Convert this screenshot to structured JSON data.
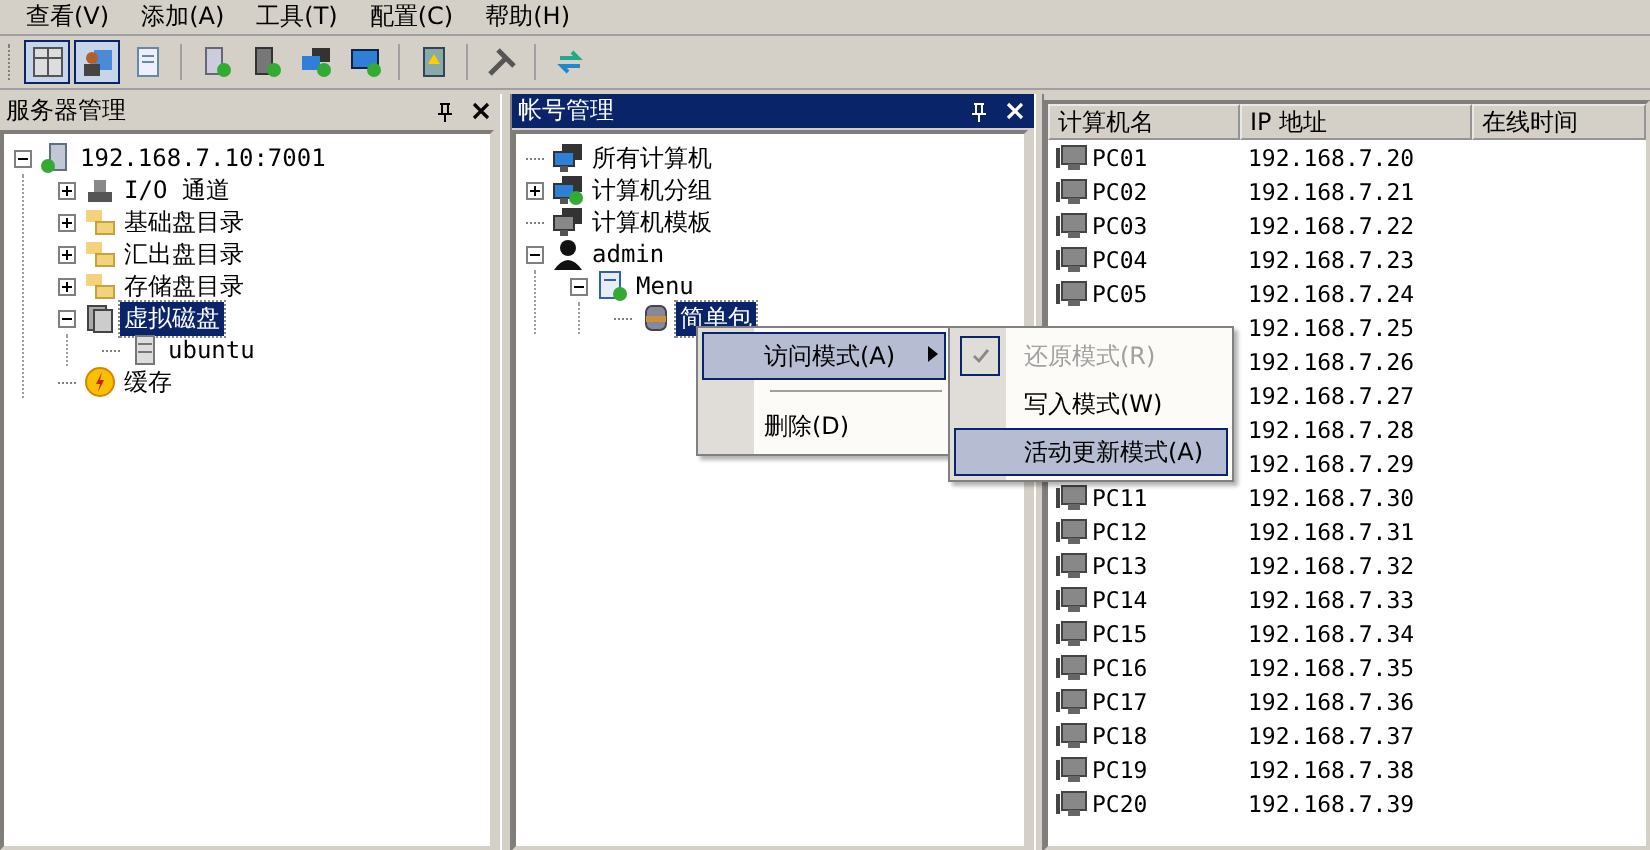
{
  "menu_bar": [
    {
      "label": "查看(V)"
    },
    {
      "label": "添加(A)"
    },
    {
      "label": "工具(T)"
    },
    {
      "label": "配置(C)"
    },
    {
      "label": "帮助(H)"
    }
  ],
  "toolbar": {
    "groups": [
      [
        {
          "kind": "grid",
          "pressed": true
        },
        {
          "kind": "person",
          "pressed": true
        },
        {
          "kind": "document",
          "pressed": false
        }
      ],
      [
        {
          "kind": "add-server",
          "pressed": false
        },
        {
          "kind": "add-tower",
          "pressed": false
        },
        {
          "kind": "add-network",
          "pressed": false
        },
        {
          "kind": "add-monitor",
          "pressed": false
        }
      ],
      [
        {
          "kind": "notebook",
          "pressed": false
        }
      ],
      [
        {
          "kind": "tools",
          "pressed": false
        }
      ],
      [
        {
          "kind": "refresh",
          "pressed": false
        }
      ]
    ]
  },
  "server_panel": {
    "title": "服务器管理",
    "tree": [
      {
        "label": "192.168.7.10:7001",
        "kind": "server",
        "expanded": true,
        "selected": false,
        "children": [
          {
            "label": "I/O 通道",
            "kind": "channel",
            "expanded": false,
            "selected": false
          },
          {
            "label": "基础盘目录",
            "kind": "folder",
            "expanded": false,
            "selected": false
          },
          {
            "label": "汇出盘目录",
            "kind": "folder",
            "expanded": false,
            "selected": false
          },
          {
            "label": "存储盘目录",
            "kind": "folder",
            "expanded": false,
            "selected": false
          },
          {
            "label": "虚拟磁盘",
            "kind": "disk",
            "expanded": true,
            "selected": true,
            "children": [
              {
                "label": "ubuntu",
                "kind": "volume",
                "selected": false
              }
            ]
          },
          {
            "label": "缓存",
            "kind": "cache",
            "selected": false
          }
        ]
      }
    ]
  },
  "account_panel": {
    "title": "帐号管理",
    "tree": [
      {
        "label": "所有计算机",
        "kind": "computers",
        "selected": false
      },
      {
        "label": "计算机分组",
        "kind": "group",
        "expanded": false,
        "selected": false
      },
      {
        "label": "计算机模板",
        "kind": "template",
        "selected": false
      },
      {
        "label": "admin",
        "kind": "user",
        "expanded": true,
        "selected": false,
        "children": [
          {
            "label": "Menu",
            "kind": "menu",
            "expanded": true,
            "selected": false,
            "children": [
              {
                "label": "简单包",
                "kind": "package",
                "selected": true
              }
            ]
          }
        ]
      }
    ]
  },
  "context_menu": {
    "items": [
      {
        "kind": "submenu",
        "label": "访问模式(A)",
        "selected": true
      },
      {
        "kind": "separator"
      },
      {
        "kind": "item",
        "label": "删除(D)",
        "selected": false
      }
    ],
    "submenu": [
      {
        "label": "还原模式(R)",
        "checked": true,
        "disabled": true,
        "selected": false
      },
      {
        "label": "写入模式(W)",
        "checked": false,
        "disabled": false,
        "selected": false
      },
      {
        "label": "活动更新模式(A)",
        "checked": false,
        "disabled": false,
        "selected": true
      }
    ]
  },
  "computer_table": {
    "columns": [
      "计算机名",
      "IP 地址",
      "在线时间"
    ],
    "rows": [
      {
        "name": "PC01",
        "ip": "192.168.7.20"
      },
      {
        "name": "PC02",
        "ip": "192.168.7.21"
      },
      {
        "name": "PC03",
        "ip": "192.168.7.22"
      },
      {
        "name": "PC04",
        "ip": "192.168.7.23"
      },
      {
        "name": "PC05",
        "ip": "192.168.7.24"
      },
      {
        "ip": "192.168.7.25"
      },
      {
        "ip": "192.168.7.26"
      },
      {
        "ip": "192.168.7.27"
      },
      {
        "ip": "192.168.7.28"
      },
      {
        "ip": "192.168.7.29"
      },
      {
        "name": "PC11",
        "ip": "192.168.7.30"
      },
      {
        "name": "PC12",
        "ip": "192.168.7.31"
      },
      {
        "name": "PC13",
        "ip": "192.168.7.32"
      },
      {
        "name": "PC14",
        "ip": "192.168.7.33"
      },
      {
        "name": "PC15",
        "ip": "192.168.7.34"
      },
      {
        "name": "PC16",
        "ip": "192.168.7.35"
      },
      {
        "name": "PC17",
        "ip": "192.168.7.36"
      },
      {
        "name": "PC18",
        "ip": "192.168.7.37"
      },
      {
        "name": "PC19",
        "ip": "192.168.7.38"
      },
      {
        "name": "PC20",
        "ip": "192.168.7.39"
      }
    ]
  }
}
